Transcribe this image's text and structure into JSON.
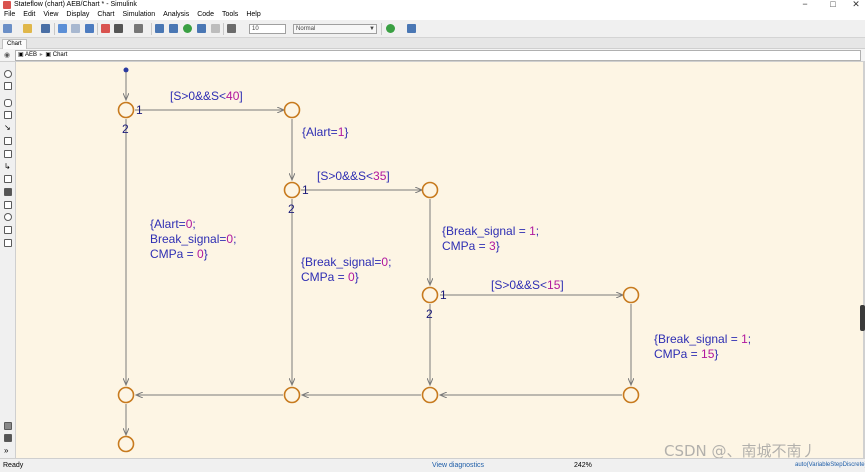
{
  "window": {
    "title": "Stateflow (chart) AEB/Chart * - Simulink",
    "minimize": "−",
    "maximize": "□",
    "close": "✕"
  },
  "menu": [
    "File",
    "Edit",
    "View",
    "Display",
    "Chart",
    "Simulation",
    "Analysis",
    "Code",
    "Tools",
    "Help"
  ],
  "toolbar": {
    "stop_time": "10",
    "sim_mode": "Normal"
  },
  "tabs": [
    {
      "label": "Chart"
    }
  ],
  "breadcrumb": {
    "model": "AEB",
    "chart": "Chart"
  },
  "chart": {
    "transitions": {
      "t1_guard_pre": "[S>0&&S<",
      "t1_guard_num": "40",
      "t1_guard_post": "]",
      "t2_guard_pre": "[S>0&&S<",
      "t2_guard_num": "35",
      "t2_guard_post": "]",
      "t3_guard_pre": "[S>0&&S<",
      "t3_guard_num": "15",
      "t3_guard_post": "]"
    },
    "actions": {
      "alart_on_pre": "{Alart=",
      "alart_on_num": "1",
      "alart_on_post": "}",
      "alart_off_l1_pre": "{Alart=",
      "alart_off_l1_num": "0",
      "alart_off_l1_post": ";",
      "alart_off_l2_pre": "Break_signal=",
      "alart_off_l2_num": "0",
      "alart_off_l2_post": ";",
      "alart_off_l3_pre": "CMPa = ",
      "alart_off_l3_num": "0",
      "alart_off_l3_post": "}",
      "brake_off_l1_pre": "{Break_signal=",
      "brake_off_l1_num": "0",
      "brake_off_l1_post": ";",
      "brake_off_l2_pre": "CMPa = ",
      "brake_off_l2_num": "0",
      "brake_off_l2_post": "}",
      "brake3_l1_pre": "{Break_signal = ",
      "brake3_l1_num": "1",
      "brake3_l1_post": ";",
      "brake3_l2_pre": "CMPa = ",
      "brake3_l2_num": "3",
      "brake3_l2_post": "}",
      "brake15_l1_pre": "{Break_signal = ",
      "brake15_l1_num": "1",
      "brake15_l1_post": ";",
      "brake15_l2_pre": "CMPa = ",
      "brake15_l2_num": "15",
      "brake15_l2_post": "}"
    },
    "orders": {
      "j1_first": "1",
      "j1_second": "2",
      "j3_first": "1",
      "j3_second": "2",
      "j5_first": "1",
      "j5_second": "2"
    },
    "colors": {
      "canvas": "#fdf5e4",
      "junction": "#c77a1e",
      "line": "#7a7a7a",
      "keyword": "#b0179e",
      "text": "#2e2eb3"
    }
  },
  "status": {
    "ready": "Ready",
    "diagnostics": "View diagnostics",
    "zoom": "242%",
    "solver": "auto(VariableStepDiscrete)"
  },
  "watermark": "CSDN @、南城不南丿"
}
